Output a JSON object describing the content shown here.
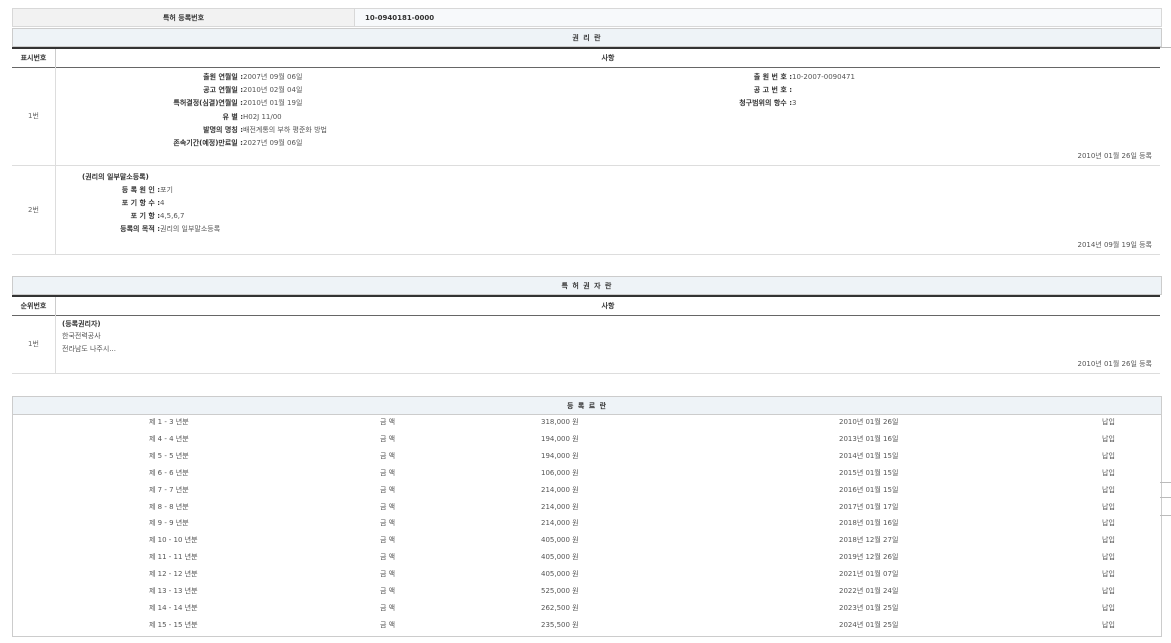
{
  "registration": {
    "label": "특허 등록번호",
    "value": "10-0940181-0000"
  },
  "section1": {
    "title": "권 리 란",
    "col_no": "표시번호",
    "col_matter": "사항",
    "rows": [
      {
        "no": "1번",
        "left": [
          {
            "k": "출원 연월일 :",
            "v": "2007년 09월 06일"
          },
          {
            "k": "공고 연월일 :",
            "v": "2010년 02월 04일"
          },
          {
            "k": "특허결정(심결)연월일 :",
            "v": "2010년 01월 19일"
          },
          {
            "k": "유 별 :",
            "v": "H02J 11/00"
          },
          {
            "k": "발명의 명칭 :",
            "v": "배전계통의 부하 평준화 방법"
          },
          {
            "k": "존속기간(예정)만료일 :",
            "v": "2027년 09월 06일"
          }
        ],
        "right": [
          {
            "k": "출 원 번 호 :",
            "v": "10-2007-0090471"
          },
          {
            "k": "공 고 번 호 :",
            "v": ""
          },
          {
            "k": "청구범위의 항수 :",
            "v": "3"
          }
        ],
        "date": "2010년 01월 26일 등록"
      },
      {
        "no": "2번",
        "title": "(권리의 일부말소등록)",
        "items": [
          {
            "k": "등 록 원 인 :",
            "v": "포기"
          },
          {
            "k": "포 기 항 수 :",
            "v": "4"
          },
          {
            "k": "포 기 항 :",
            "v": "4,5,6,7"
          },
          {
            "k": "등록의 목적 :",
            "v": "권리의 일부말소등록"
          }
        ],
        "date": "2014년 09월 19일 등록"
      }
    ]
  },
  "section2": {
    "title": "특 허 권 자 란",
    "col_no": "순위번호",
    "col_matter": "사항",
    "row": {
      "no": "1번",
      "title": "(등록권리자)",
      "line1": "한국전력공사",
      "line2": "전라남도 나주시...",
      "date": "2010년 01월 26일 등록"
    }
  },
  "section3": {
    "title": "등 록 료 란",
    "rows": [
      {
        "year": "제 1 - 3 년분",
        "label": "금 액",
        "amount": "318,000 원",
        "date": "2010년 01월 26일",
        "status": "납입"
      },
      {
        "year": "제 4 - 4 년분",
        "label": "금 액",
        "amount": "194,000 원",
        "date": "2013년 01월 16일",
        "status": "납입"
      },
      {
        "year": "제 5 - 5 년분",
        "label": "금 액",
        "amount": "194,000 원",
        "date": "2014년 01월 15일",
        "status": "납입"
      },
      {
        "year": "제 6 - 6 년분",
        "label": "금 액",
        "amount": "106,000 원",
        "date": "2015년 01월 15일",
        "status": "납입"
      },
      {
        "year": "제 7 - 7 년분",
        "label": "금 액",
        "amount": "214,000 원",
        "date": "2016년 01월 15일",
        "status": "납입"
      },
      {
        "year": "제 8 - 8 년분",
        "label": "금 액",
        "amount": "214,000 원",
        "date": "2017년 01월 17일",
        "status": "납입"
      },
      {
        "year": "제 9 - 9 년분",
        "label": "금 액",
        "amount": "214,000 원",
        "date": "2018년 01월 16일",
        "status": "납입"
      },
      {
        "year": "제 10 - 10 년분",
        "label": "금 액",
        "amount": "405,000 원",
        "date": "2018년 12월 27일",
        "status": "납입"
      },
      {
        "year": "제 11 - 11 년분",
        "label": "금 액",
        "amount": "405,000 원",
        "date": "2019년 12월 26일",
        "status": "납입"
      },
      {
        "year": "제 12 - 12 년분",
        "label": "금 액",
        "amount": "405,000 원",
        "date": "2021년 01월 07일",
        "status": "납입"
      },
      {
        "year": "제 13 - 13 년분",
        "label": "금 액",
        "amount": "525,000 원",
        "date": "2022년 01월 24일",
        "status": "납입"
      },
      {
        "year": "제 14 - 14 년분",
        "label": "금 액",
        "amount": "262,500 원",
        "date": "2023년 01월 25일",
        "status": "납입"
      },
      {
        "year": "제 15 - 15 년분",
        "label": "금 액",
        "amount": "235,500 원",
        "date": "2024년 01월 25일",
        "status": "납입"
      }
    ]
  }
}
